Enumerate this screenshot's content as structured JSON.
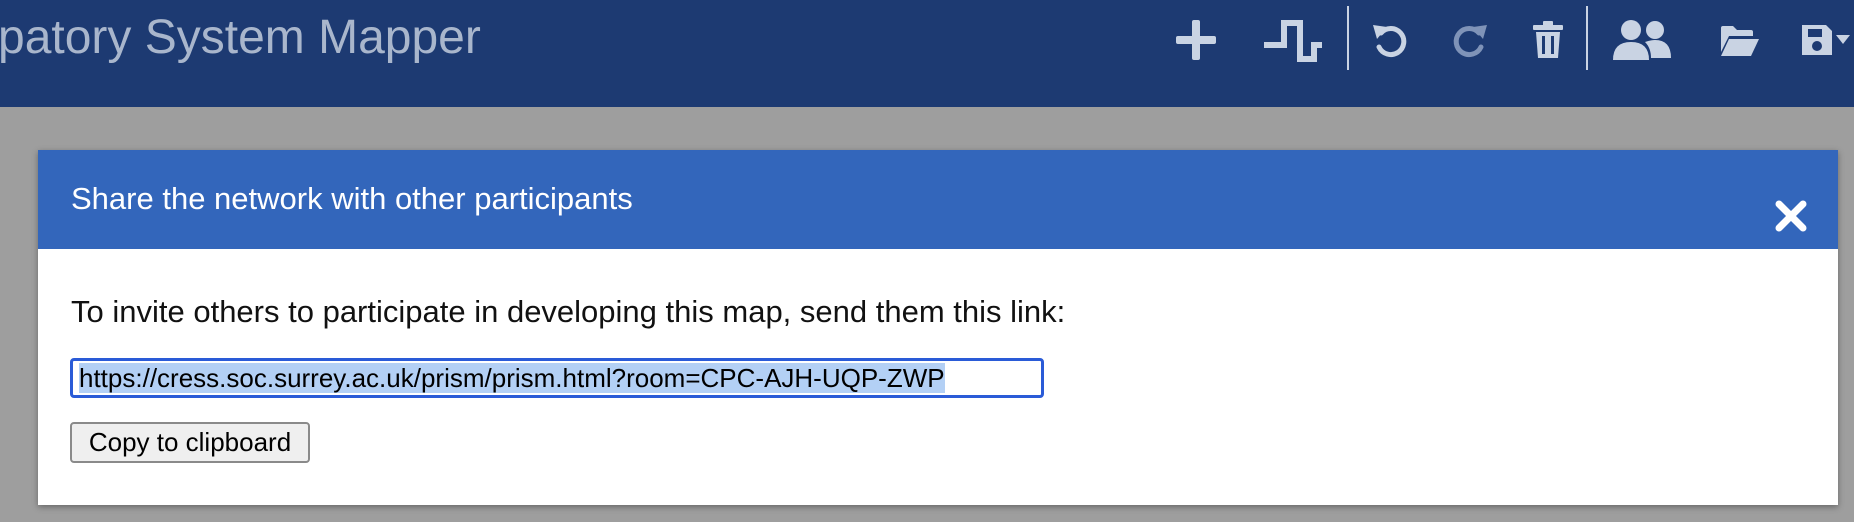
{
  "app": {
    "title": "patory System Mapper"
  },
  "toolbar": {
    "icons": [
      "plus-icon",
      "step-line-icon",
      "undo-icon",
      "redo-icon",
      "trash-icon",
      "users-icon",
      "folder-open-icon",
      "save-icon",
      "caret-down-icon"
    ],
    "colors": {
      "navbar_bg": "#1d3a72",
      "icon_active": "#c9d3e3",
      "icon_disabled": "#7f93b8"
    }
  },
  "dialog": {
    "title": "Share the network with other participants",
    "close_label": "✕",
    "instruction": "To invite others to participate in developing this map, send them this link:",
    "link_value": "https://cress.soc.surrey.ac.uk/prism/prism.html?room=CPC-AJH-UQP-ZWP",
    "copy_button_label": "Copy to clipboard",
    "colors": {
      "header_bg": "#3366bb",
      "input_border": "#2a5bd7",
      "selection": "#b3d0f5"
    }
  }
}
